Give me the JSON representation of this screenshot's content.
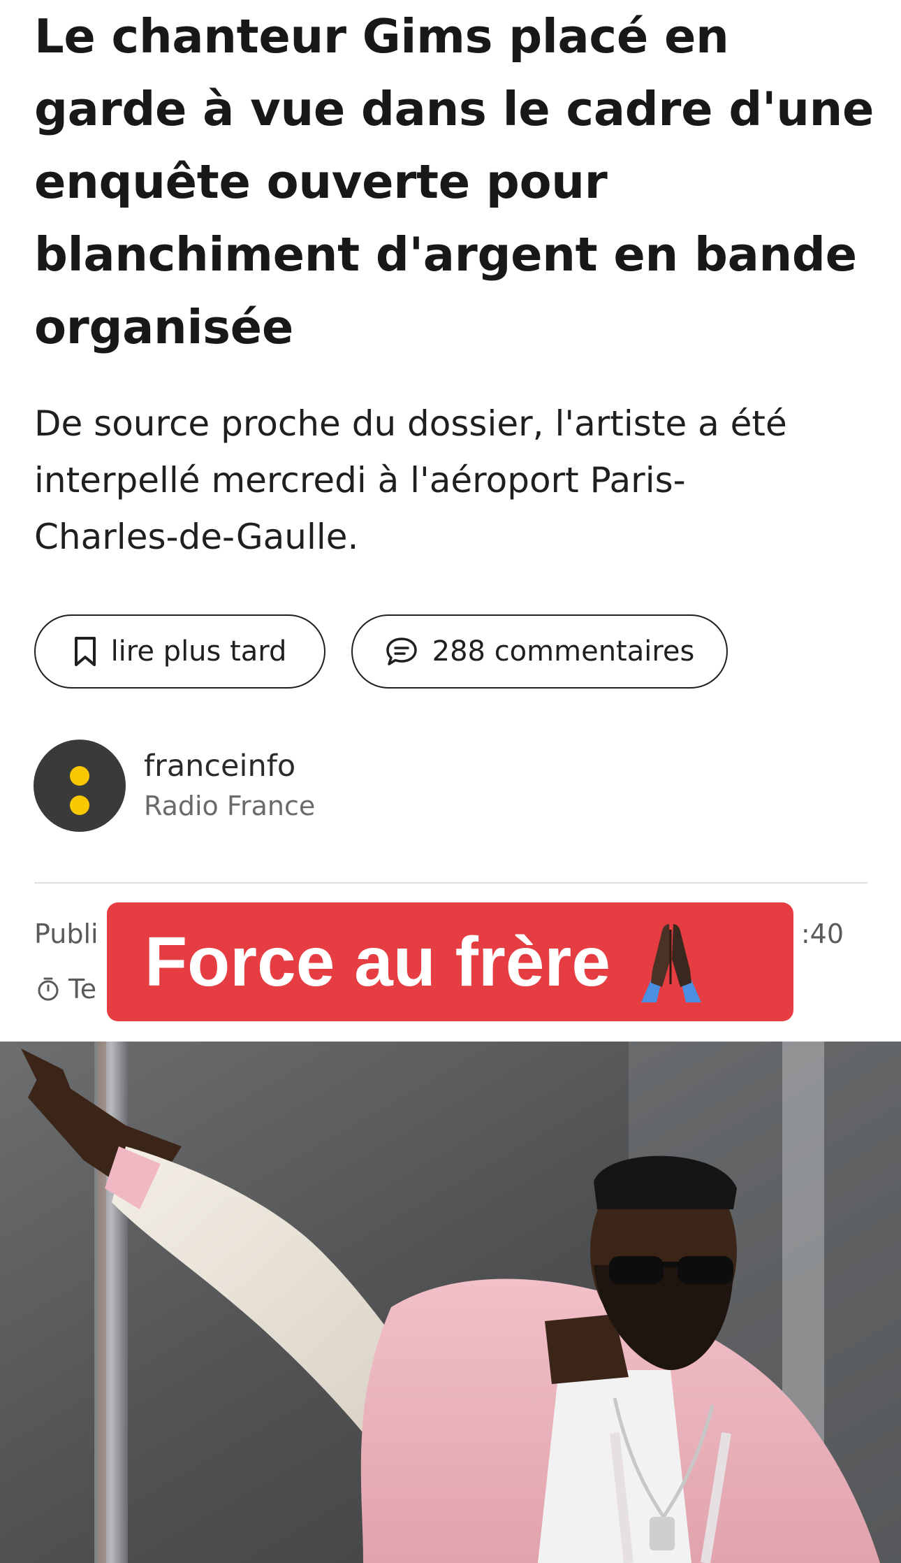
{
  "article": {
    "headline_lines": [
      "Le chanteur Gims placé en",
      "garde à vue dans le cadre d'une",
      "enquête ouverte pour",
      "blanchiment d'argent en bande",
      "organisée"
    ],
    "lead_lines": [
      "De source proche du dossier, l'artiste a été",
      "interpellé mercredi à l'aéroport Paris-",
      "Charles-de-Gaulle."
    ]
  },
  "actions": {
    "read_later": {
      "label": "lire plus tard",
      "icon": "bookmark-icon"
    },
    "comments": {
      "label": "288 commentaires",
      "icon": "comment-icon"
    }
  },
  "author": {
    "name": "franceinfo",
    "org": "Radio France",
    "logo_colors": {
      "background": "#3a3a3a",
      "dots": "#f9c800"
    }
  },
  "meta": {
    "published_partial": "Publi",
    "time_partial": ":40",
    "reading_partial": "Te",
    "reading_icon": "timer-icon"
  },
  "overlay": {
    "text": "Force au frère",
    "emoji": "folded-hands-icon",
    "background": "#e53d41"
  },
  "photo": {
    "subject": "man in sunglasses and pink jacket pointing"
  }
}
